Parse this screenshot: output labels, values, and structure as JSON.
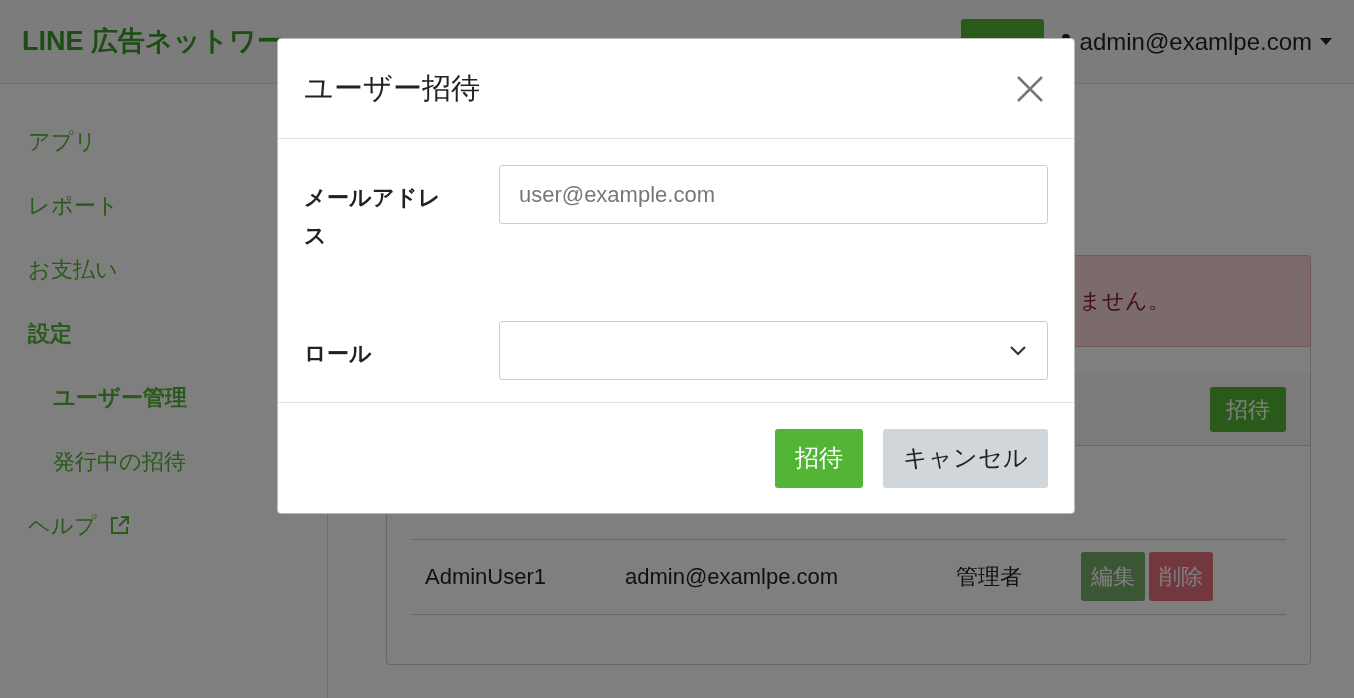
{
  "navbar": {
    "brand": "LINE 広告ネットワー",
    "user": "admin@examlpe.com"
  },
  "sidebar": {
    "items": [
      {
        "label": "アプリ",
        "selected": false
      },
      {
        "label": "レポート",
        "selected": false
      },
      {
        "label": "お支払い",
        "selected": false
      },
      {
        "label": "設定",
        "selected": false,
        "expanded": true,
        "children": [
          {
            "label": "ユーザー管理",
            "selected": true
          },
          {
            "label": "発行中の招待",
            "selected": false
          }
        ]
      },
      {
        "label": "ヘルプ",
        "selected": false,
        "external": true
      }
    ]
  },
  "alert": {
    "text": "ません。"
  },
  "card": {
    "invite_button": "招待",
    "table": {
      "rows": [
        {
          "cells": [
            "AdminUser1",
            "admin@examlpe.com",
            "管理者"
          ],
          "actions": [
            {
              "label": "編集",
              "kind": "edit",
              "disabled": true
            },
            {
              "label": "削除",
              "kind": "delete",
              "disabled": true
            }
          ]
        }
      ]
    }
  },
  "modal": {
    "title": "ユーザー招待",
    "fields": [
      {
        "kind": "text",
        "label": "メールアドレス",
        "placeholder": "user@example.com"
      },
      {
        "kind": "select",
        "label": "ロール"
      }
    ],
    "buttons": [
      {
        "label": "招待",
        "kind": "primary"
      },
      {
        "label": "キャンセル",
        "kind": "secondary"
      }
    ]
  }
}
